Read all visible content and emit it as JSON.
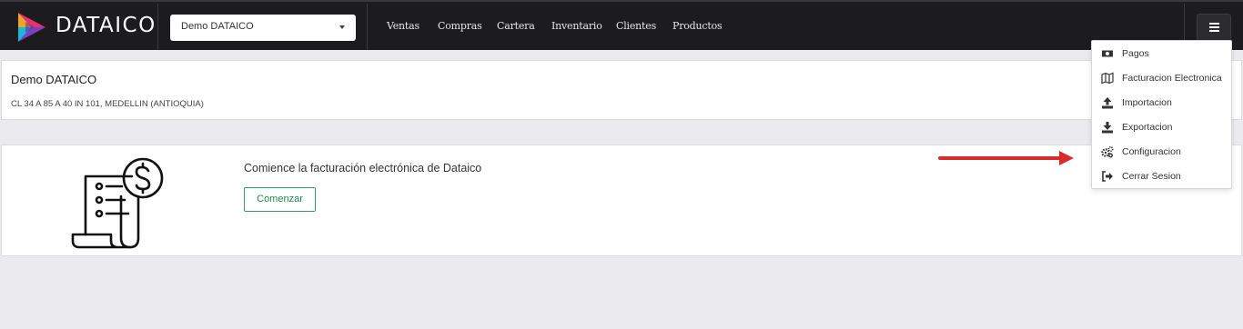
{
  "app": {
    "brand": "DATAICO"
  },
  "header": {
    "company_select": {
      "value": "Demo DATAICO"
    },
    "nav": [
      {
        "label": "Ventas"
      },
      {
        "label": "Compras"
      },
      {
        "label": "Cartera"
      },
      {
        "label": "Inventario"
      },
      {
        "label": "Clientes"
      },
      {
        "label": "Productos"
      }
    ]
  },
  "company_card": {
    "title": "Demo DATAICO",
    "address": "CL 34 A 85 A 40 IN 101, MEDELLIN (ANTIOQUIA)"
  },
  "onboarding": {
    "text": "Comience la facturación electrónica de Dataico",
    "button_label": "Comenzar"
  },
  "user_menu": {
    "items": [
      {
        "label": "Pagos",
        "icon": "money-icon"
      },
      {
        "label": "Facturacion Electronica",
        "icon": "map-icon"
      },
      {
        "label": "Importacion",
        "icon": "upload-icon"
      },
      {
        "label": "Exportacion",
        "icon": "download-icon"
      },
      {
        "label": "Configuracion",
        "icon": "gears-icon"
      },
      {
        "label": "Cerrar Sesion",
        "icon": "sign-out-icon"
      }
    ]
  },
  "colors": {
    "navbar_bg": "#1c1c1e",
    "page_bg": "#ebebef",
    "accent_green": "#2ca25f",
    "annotation_arrow": "#d92b2b"
  }
}
